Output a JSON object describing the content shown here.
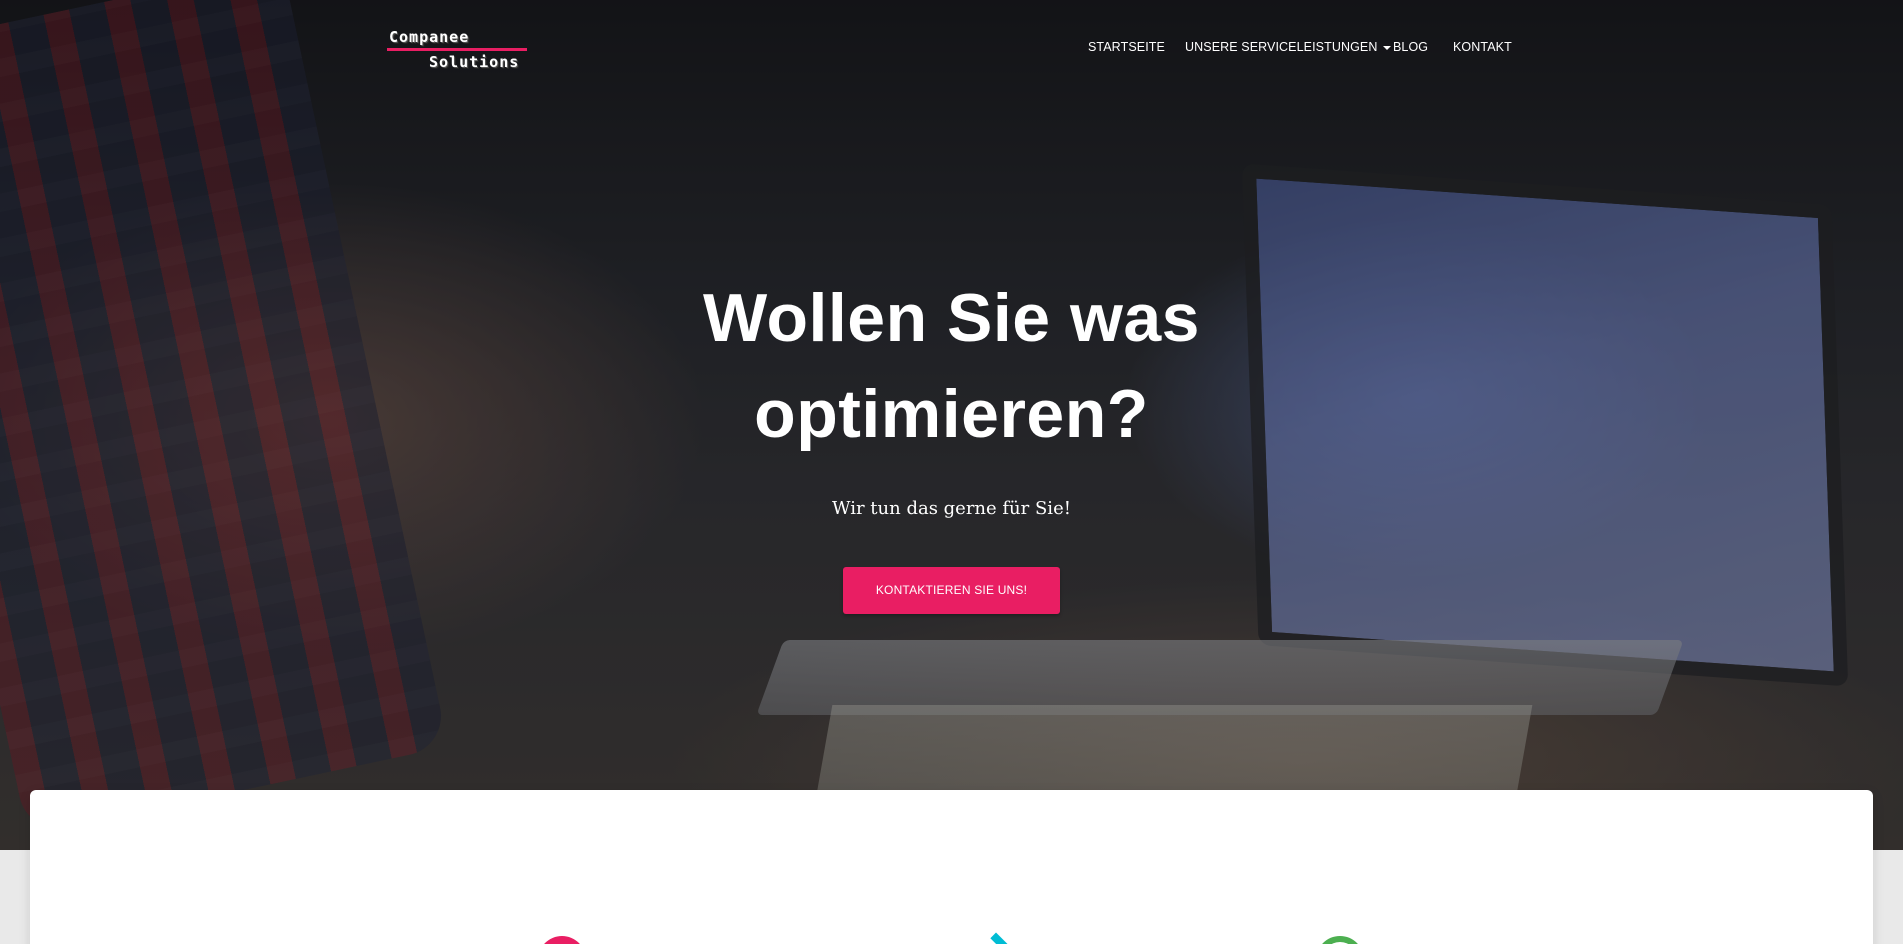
{
  "brand": {
    "logo_line1": "Companee",
    "logo_line2": "Solutions",
    "accent_color": "#e91e63"
  },
  "nav": {
    "items": [
      {
        "label": "STARTSEITE"
      },
      {
        "label": "UNSERE SERVICELEISTUNGEN",
        "has_dropdown": true
      },
      {
        "label": "BLOG"
      },
      {
        "label": "KONTAKT"
      }
    ]
  },
  "hero": {
    "title_line1": "Wollen Sie was",
    "title_line2": "optimieren?",
    "subtitle": "Wir tun das gerne für Sie!",
    "cta_label": "KONTAKTIEREN SIE UNS!"
  },
  "features": {
    "icons": [
      "pink-circle-icon",
      "cyan-icon",
      "green-circle-icon"
    ],
    "colors": [
      "#e91e63",
      "#00bcd4",
      "#4caf50"
    ]
  }
}
